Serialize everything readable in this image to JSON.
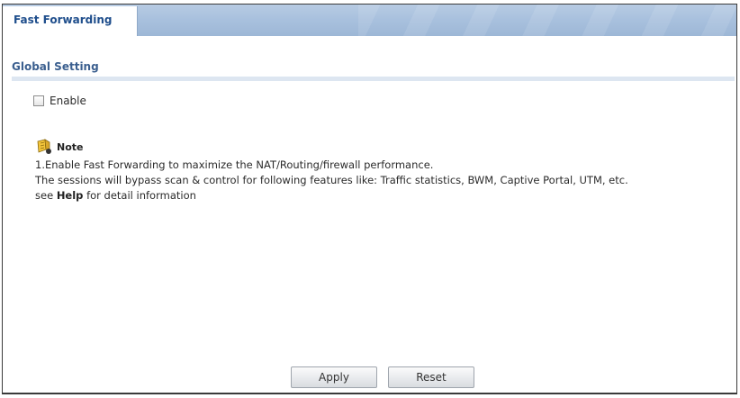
{
  "tabs": [
    {
      "label": "Fast Forwarding",
      "active": true
    }
  ],
  "global_setting": {
    "title": "Global Setting",
    "enable_label": "Enable",
    "enable_checked": false
  },
  "note": {
    "icon": "note-pin-icon",
    "title": "Note",
    "line1": "1.Enable Fast Forwarding to maximize the NAT/Routing/firewall performance.",
    "line2": "The sessions will bypass scan & control for following features like: Traffic statistics, BWM, Captive Portal, UTM, etc.",
    "line3_prefix": "see ",
    "line3_help": "Help",
    "line3_suffix": " for detail information"
  },
  "buttons": {
    "apply": "Apply",
    "reset": "Reset"
  },
  "colors": {
    "tab_text": "#1f4e8c",
    "header_bar": "#a9c1de",
    "section_title": "#3b5f8f"
  }
}
